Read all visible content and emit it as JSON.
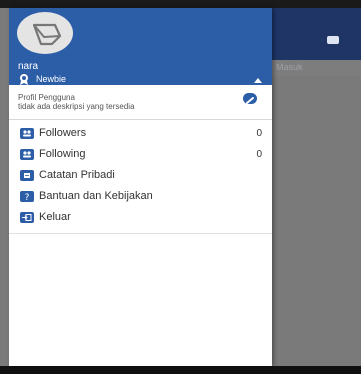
{
  "background": {
    "subbar_text": "Masuk"
  },
  "drawer": {
    "user_name": "nara",
    "rank": "Newbie",
    "profile": {
      "title": "Profil Pengguna",
      "description": "tidak ada deskripsi yang tersedia"
    },
    "menu": [
      {
        "label": "Followers",
        "count": "0",
        "icon": "people-icon"
      },
      {
        "label": "Following",
        "count": "0",
        "icon": "people-icon"
      },
      {
        "label": "Catatan Pribadi",
        "icon": "note-icon"
      },
      {
        "label": "Bantuan dan Kebijakan",
        "icon": "help-icon"
      },
      {
        "label": "Keluar",
        "icon": "logout-icon"
      }
    ]
  },
  "colors": {
    "header_blue": "#2c5ea8",
    "app_bar_blue": "#1e3566"
  }
}
